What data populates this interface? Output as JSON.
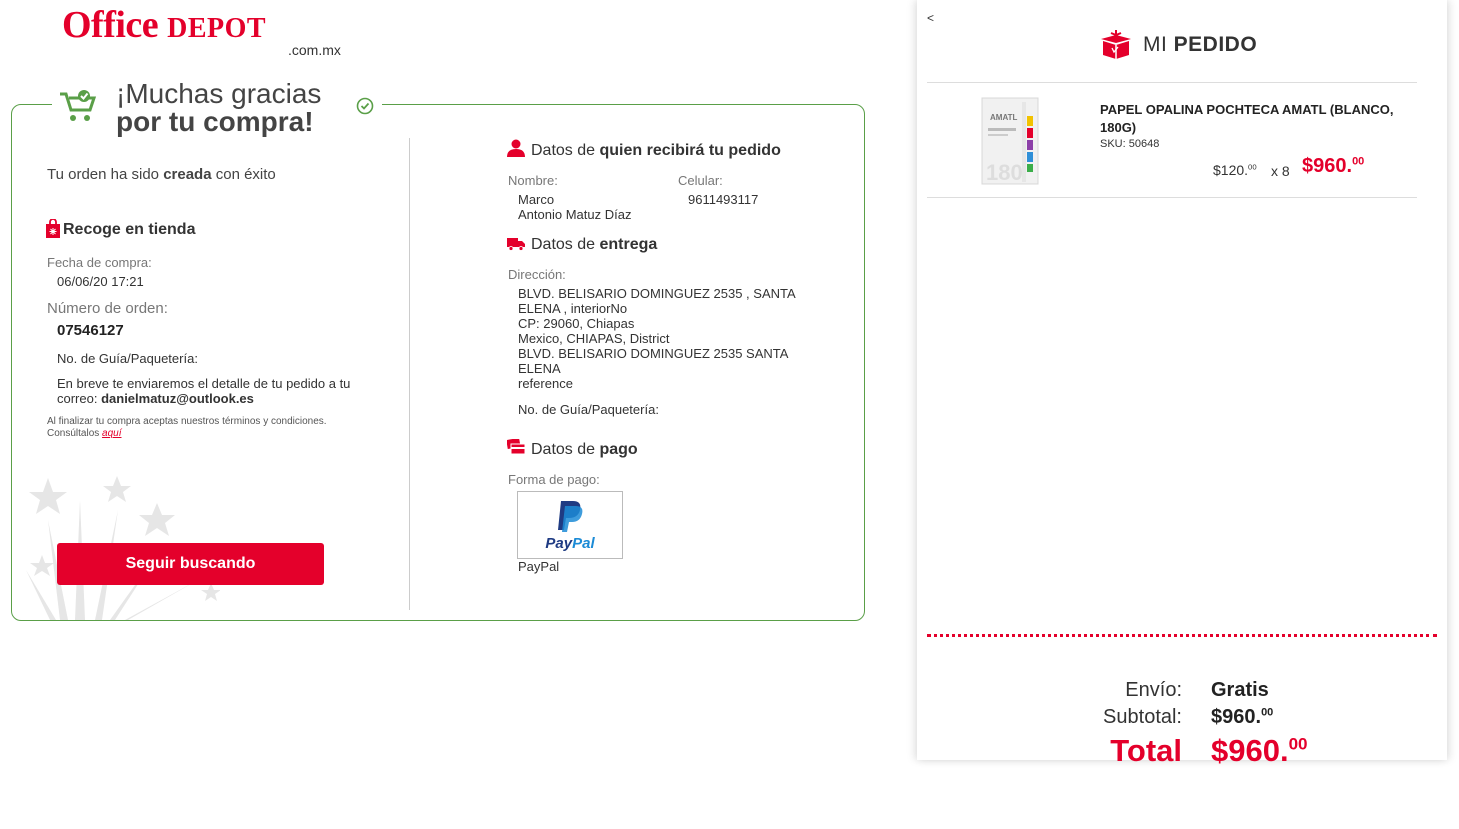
{
  "brand": {
    "name_office": "Office",
    "name_depot": "DEPOT",
    "domain": ".com.mx",
    "accent": "#e4002b",
    "green": "#5a9f48"
  },
  "confirmation": {
    "title_line1": "¡Muchas gracias",
    "title_line2": "por tu compra!",
    "status_pre": "Tu orden ha sido ",
    "status_bold": "creada",
    "status_post": " con éxito",
    "pickup_title": "Recoge en tienda",
    "purchase_date_label": "Fecha de compra:",
    "purchase_date": "06/06/20 17:21",
    "order_number_label": "Número de orden:",
    "order_number": "07546127",
    "tracking_label": "No. de Guía/Paquetería:",
    "email_note": "En breve te enviaremos el detalle de tu pedido a tu",
    "email_prefix": "correo: ",
    "email": "danielmatuz@outlook.es",
    "terms_line1": "Al finalizar tu compra aceptas nuestros términos y condiciones.",
    "terms_line2": "Consúltalos ",
    "terms_link": "aquí",
    "continue_button": "Seguir buscando"
  },
  "recipient": {
    "title_pre": "Datos de ",
    "title_bold": "quien recibirá tu pedido",
    "name_label": "Nombre:",
    "name_line1": "Marco",
    "name_line2": "Antonio Matuz Díaz",
    "phone_label": "Celular:",
    "phone": "9611493117"
  },
  "delivery": {
    "title_pre": "Datos de ",
    "title_bold": "entrega",
    "address_label": "Dirección:",
    "address_lines": [
      "BLVD. BELISARIO DOMINGUEZ 2535 , SANTA",
      "ELENA , interiorNo",
      "CP: 29060, Chiapas",
      "Mexico, CHIAPAS, District",
      "BLVD. BELISARIO DOMINGUEZ 2535  SANTA",
      "ELENA",
      "reference"
    ],
    "tracking_label": "No. de Guía/Paquetería:"
  },
  "payment": {
    "title_pre": "Datos de ",
    "title_bold": "pago",
    "method_label": "Forma de pago:",
    "logo_pay": "Pay",
    "logo_pal": "Pal",
    "method": "PayPal"
  },
  "order_panel": {
    "back": "<",
    "title_pre": "MI ",
    "title_bold": "PEDIDO",
    "item": {
      "name": "PAPEL OPALINA POCHTECA AMATL (BLANCO, 180G)",
      "sku": "SKU: 50648",
      "unit_price": "$120.",
      "unit_price_cents": "00",
      "qty": "x 8",
      "total": "$960.",
      "total_cents": "00",
      "image_brand": "AMATL",
      "image_weight": "180"
    },
    "shipping_label": "Envío:",
    "shipping_value": "Gratis",
    "subtotal_label": "Subtotal:",
    "subtotal_value": "$960.",
    "subtotal_cents": "00",
    "total_label": "Total",
    "total_value": "$960.",
    "total_cents": "00"
  }
}
